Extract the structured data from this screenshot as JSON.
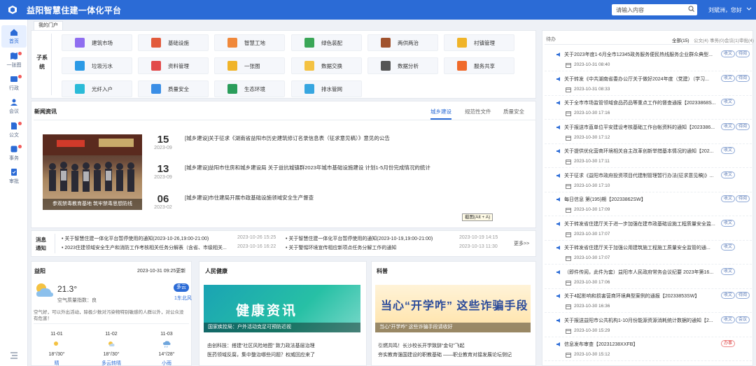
{
  "app": {
    "title": "益阳智慧住建一体化平台"
  },
  "search": {
    "placeholder": "请输入内容"
  },
  "user": {
    "greeting": "刘斌洲，您好"
  },
  "sidebar": {
    "items": [
      {
        "label": "首页"
      },
      {
        "label": "一张图"
      },
      {
        "label": "行政"
      },
      {
        "label": "会议"
      },
      {
        "label": "公文"
      },
      {
        "label": "事务"
      },
      {
        "label": "审批"
      }
    ]
  },
  "portal_tab": "我的门户",
  "subsystem": {
    "title": "子系统",
    "items": [
      {
        "label": "建筑市场",
        "color": "#8f6ef0"
      },
      {
        "label": "基础设施",
        "color": "#e25b3c"
      },
      {
        "label": "智慧工地",
        "color": "#f0883a"
      },
      {
        "label": "绿色装配",
        "color": "#3aa657"
      },
      {
        "label": "两供两治",
        "color": "#a0522d"
      },
      {
        "label": "村镇管理",
        "color": "#f0b429"
      },
      {
        "label": "垃圾污水",
        "color": "#2b9ae6"
      },
      {
        "label": "资料管理",
        "color": "#e24b4b"
      },
      {
        "label": "一张图",
        "color": "#f0b429"
      },
      {
        "label": "数据交换",
        "color": "#f4c242"
      },
      {
        "label": "数据分析",
        "color": "#555555"
      },
      {
        "label": "服务共享",
        "color": "#f06a2a"
      },
      {
        "label": "光纤入户",
        "color": "#2bbbd8"
      },
      {
        "label": "质量安全",
        "color": "#3a8ee6"
      },
      {
        "label": "生态环境",
        "color": "#2a9d5b"
      },
      {
        "label": "排水管网",
        "color": "#37a6e0"
      }
    ]
  },
  "news": {
    "title": "新闻资讯",
    "tabs": [
      "城乡建设",
      "规范性文件",
      "质量安全"
    ],
    "image_caption": "参观禁毒教育基地 筑牢禁毒思想防线",
    "items": [
      {
        "day": "15",
        "ym": "2023-09",
        "text": "[城乡建设]关于征求《湖南省益阳市历史建筑修订名录信息表（征求意见稿）》意见的公告"
      },
      {
        "day": "13",
        "ym": "2023-09",
        "text": "[城乡建设]益阳市住房和城乡建设局 关于益抗城镇群2023年城市基础设施建设 计划1-5月份完成情况的统计"
      },
      {
        "day": "06",
        "ym": "2023-02",
        "text": "[城乡建设]市住建局开展市政基础设施领域安全生产督查"
      }
    ],
    "tooltip": "截图(Alt + A)"
  },
  "messages": {
    "label": "消息通知",
    "more": "更多>>",
    "items": [
      {
        "text": "关于智慧住建一体化平台暂停使用的通知(2023-10-26,19:00-21:00)",
        "date": "2023-10-26 15:25"
      },
      {
        "text": "关于智慧住建一体化平台暂停使用的通知(2023-10-19,19:00-21:00)",
        "date": "2023-10-19 14:15"
      },
      {
        "text": "2023住建领域安全生产和消防工作考核相关任务分解表（含省、市级相关...",
        "date": "2023-10-16 16:22"
      },
      {
        "text": "关于警惕环境宣传相应新项点任务分解工作的通知",
        "date": "2023-10-13 11:30"
      }
    ]
  },
  "weather": {
    "city": "益阳",
    "updated": "2023-10-31 09:25更新",
    "temp": "21.3°",
    "aq": "空气质量指数：良",
    "condition": "多云",
    "wind": "1东北风",
    "tip": "空气好，可以外出活动，除极少数对污染物特别敏感的人群以外，对公众没有危害！",
    "forecast": [
      {
        "date": "11-01",
        "temp": "18°/30°",
        "label": "晴"
      },
      {
        "date": "11-02",
        "temp": "18°/30°",
        "label": "多云转晴"
      },
      {
        "date": "11-03",
        "temp": "14°/28°",
        "label": "小雨"
      }
    ]
  },
  "health": {
    "title": "人民健康",
    "banner": "健康资讯",
    "caption": "国家疾控局：户外活动克足可预防近视",
    "links": [
      "由创科技：搭建“社区风险地图” 致力政法基层治理",
      "医药领域反腐，集中整治哪些问题？权威回应来了"
    ]
  },
  "science": {
    "title": "科普",
    "banner": "当心“开学咋” 这些诈骗手段",
    "caption": "当心“开学咋” 这些诈骗手段请收好",
    "links": [
      "引燃共鸣！长沙校长开学致辞“金句”飞起",
      "夯实教育强国建设的职教基础 ——职业教育对接发展论坛侧记"
    ]
  },
  "todo": {
    "title": "待办",
    "filters": [
      "全部(15)",
      "公文(4)",
      "事务(0)",
      "会议(1)",
      "审批(4)"
    ],
    "items": [
      {
        "title": "关于2023年度1-6月全市12345政务服务便民热线服务企业群众典型...",
        "date": "2023-10-31 08:40",
        "tags": [
          "收文",
          "待阅"
        ]
      },
      {
        "title": "关于转发《中共湖南省委办公厅关于做好2024年度（党建）（学习...",
        "date": "2023-10-31 08:33",
        "tags": [
          "收文",
          "待阅"
        ]
      },
      {
        "title": "关于全市市场监管领域食品药品等重点工作的督查通报【20233868S...",
        "date": "2023-10-30 17:16",
        "tags": [
          "收文"
        ]
      },
      {
        "title": "关于报送市直单位平安建设考核基础工作台帐资料的通知【2023386...",
        "date": "2023-10-30 17:12",
        "tags": [
          "收文",
          "待阅"
        ]
      },
      {
        "title": "关于提供优化营商环境相关自主改革创新举措基本情况的通知【202...",
        "date": "2023-10-30 17:11",
        "tags": [
          "收文"
        ]
      },
      {
        "title": "关于征求《益阳市政府投资项目代建制管理暂行办法(征求意见稿)》...",
        "date": "2023-10-30 17:10",
        "tags": [
          "收文"
        ]
      },
      {
        "title": "每日信息 第(195)期【20233862SW】",
        "date": "2023-10-30 17:09",
        "tags": [
          "收文",
          "待阅"
        ]
      },
      {
        "title": "关于转发省住建厅关于进一步加强在建市政基础设施工程质量安全监...",
        "date": "2023-10-30 17:07",
        "tags": [
          "收文"
        ]
      },
      {
        "title": "关于转发省住建厅关于加强公用建筑施工程施工质量安全监管的通...",
        "date": "2023-10-30 17:07",
        "tags": [
          "收文"
        ]
      },
      {
        "title": "（即件传阅，此件为套）益阳市人民政府常务会议纪要 2023年第16...",
        "date": "2023-10-30 17:06",
        "tags": [
          "收文"
        ]
      },
      {
        "title": "关于4起影响和损害营商环境典型案例的通报【20233853SW】",
        "date": "2023-10-30 16:36",
        "tags": [
          "收文",
          "待阅"
        ]
      },
      {
        "title": "关于报送益阳市公共机构1-10月份能源资源消耗统计数据的通知【2...",
        "date": "2023-10-30 15:29",
        "tags": [
          "收文",
          "会议"
        ]
      },
      {
        "title": "信息发布审查【20231238XXFB】",
        "date": "2023-10-30 15:12",
        "tags": [
          "办事"
        ]
      }
    ]
  }
}
